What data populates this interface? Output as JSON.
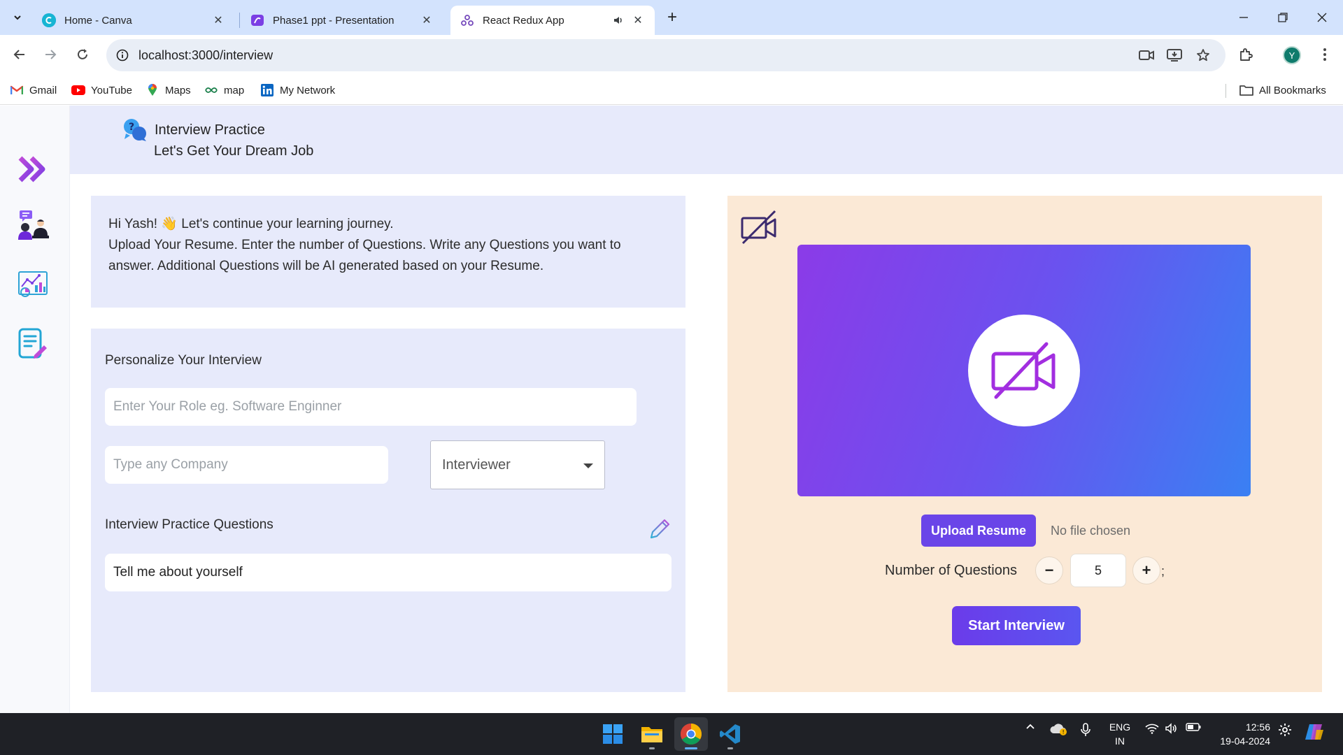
{
  "browser": {
    "tabs": [
      {
        "title": "Home - Canva",
        "active": false
      },
      {
        "title": "Phase1 ppt - Presentation",
        "active": false
      },
      {
        "title": "React Redux App",
        "active": true
      }
    ],
    "url": "localhost:3000/interview",
    "profile_initial": "Y",
    "bookmarks": [
      {
        "label": "Gmail",
        "icon": "gmail-icon"
      },
      {
        "label": "YouTube",
        "icon": "youtube-icon"
      },
      {
        "label": "Maps",
        "icon": "maps-icon"
      },
      {
        "label": "map",
        "icon": "link-icon"
      },
      {
        "label": "My Network",
        "icon": "linkedin-icon"
      }
    ],
    "all_bookmarks": "All Bookmarks"
  },
  "app": {
    "header": {
      "title": "Interview Practice",
      "subtitle": "Let's Get Your Dream Job"
    },
    "sidebar": {
      "items": [
        {
          "icon": "double-chevron-right-icon"
        },
        {
          "icon": "interview-people-icon"
        },
        {
          "icon": "analytics-chart-icon"
        },
        {
          "icon": "document-edit-icon"
        }
      ]
    },
    "welcome": {
      "greeting": "Hi Yash! 👋 Let's continue your learning journey.",
      "body": "Upload Your Resume. Enter the number of Questions. Write any Questions you want to answer. Additional Questions will be AI generated based on your Resume."
    },
    "form": {
      "heading": "Personalize Your Interview",
      "role_placeholder": "Enter Your Role eg. Software Enginner",
      "company_placeholder": "Type any Company",
      "interviewer_selected": "Interviewer",
      "questions_heading": "Interview Practice Questions",
      "question_1": "Tell me about yourself"
    },
    "video": {
      "upload_label": "Upload Resume",
      "file_status": "No file chosen",
      "num_questions_label": "Number of Questions",
      "num_questions_value": "5",
      "minus": "−",
      "plus": "+",
      "trailing": ";",
      "start_label": "Start Interview"
    }
  },
  "taskbar": {
    "lang_top": "ENG",
    "lang_bottom": "IN",
    "time": "12:56",
    "date": "19-04-2024"
  },
  "colors": {
    "tabbar_bg": "#d3e3fd",
    "panel_lavender": "#e7eafb",
    "panel_peach": "#fbe9d6",
    "accent_purple": "#6a45e8",
    "gradient_start": "#8b3be8",
    "gradient_end": "#3a80f3"
  }
}
